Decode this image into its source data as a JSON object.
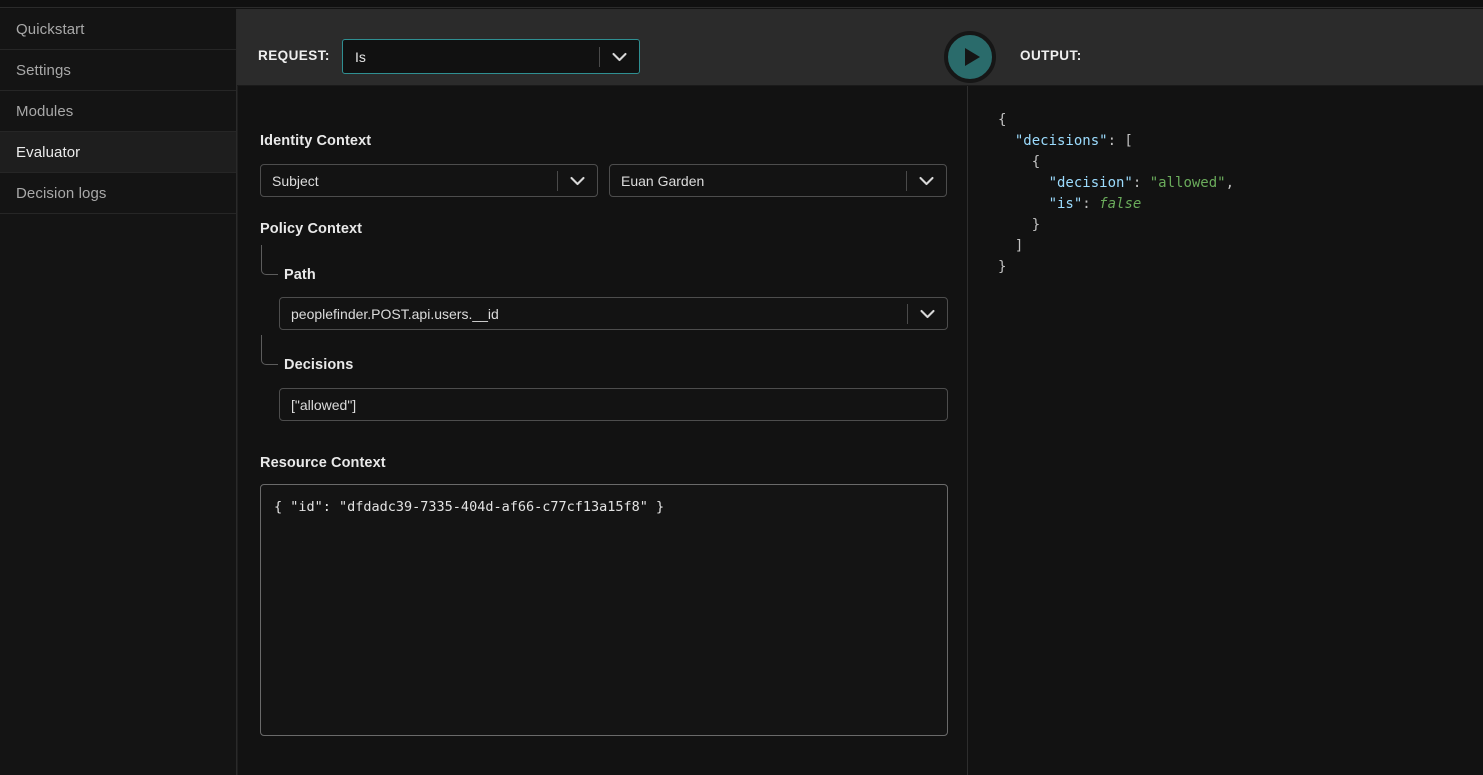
{
  "sidebar": {
    "items": [
      {
        "label": "Quickstart",
        "active": false
      },
      {
        "label": "Settings",
        "active": false
      },
      {
        "label": "Modules",
        "active": false
      },
      {
        "label": "Evaluator",
        "active": true
      },
      {
        "label": "Decision logs",
        "active": false
      }
    ]
  },
  "topbar": {
    "request_label": "REQUEST:",
    "request_value": "Is",
    "output_label": "OUTPUT:",
    "run_icon": "play-icon",
    "accent_color": "#2a6b6b",
    "request_border_color": "#2f8f92"
  },
  "form": {
    "identity_context": {
      "title": "Identity Context",
      "type_value": "Subject",
      "subject_value": "Euan Garden"
    },
    "policy_context": {
      "title": "Policy Context",
      "path_label": "Path",
      "path_value": "peoplefinder.POST.api.users.__id",
      "decisions_label": "Decisions",
      "decisions_value": "[\"allowed\"]"
    },
    "resource_context": {
      "title": "Resource Context",
      "value": "{ \"id\": \"dfdadc39-7335-404d-af66-c77cf13a15f8\" }"
    }
  },
  "output": {
    "json": {
      "line1": "{",
      "line2_key": "\"decisions\"",
      "line2_rest": ": [",
      "line3": "{",
      "line4_key": "\"decision\"",
      "line4_colon": ": ",
      "line4_val": "\"allowed\"",
      "line4_comma": ",",
      "line5_key": "\"is\"",
      "line5_colon": ": ",
      "line5_val": "false",
      "line6": "}",
      "line7": "]",
      "line8": "}"
    }
  }
}
